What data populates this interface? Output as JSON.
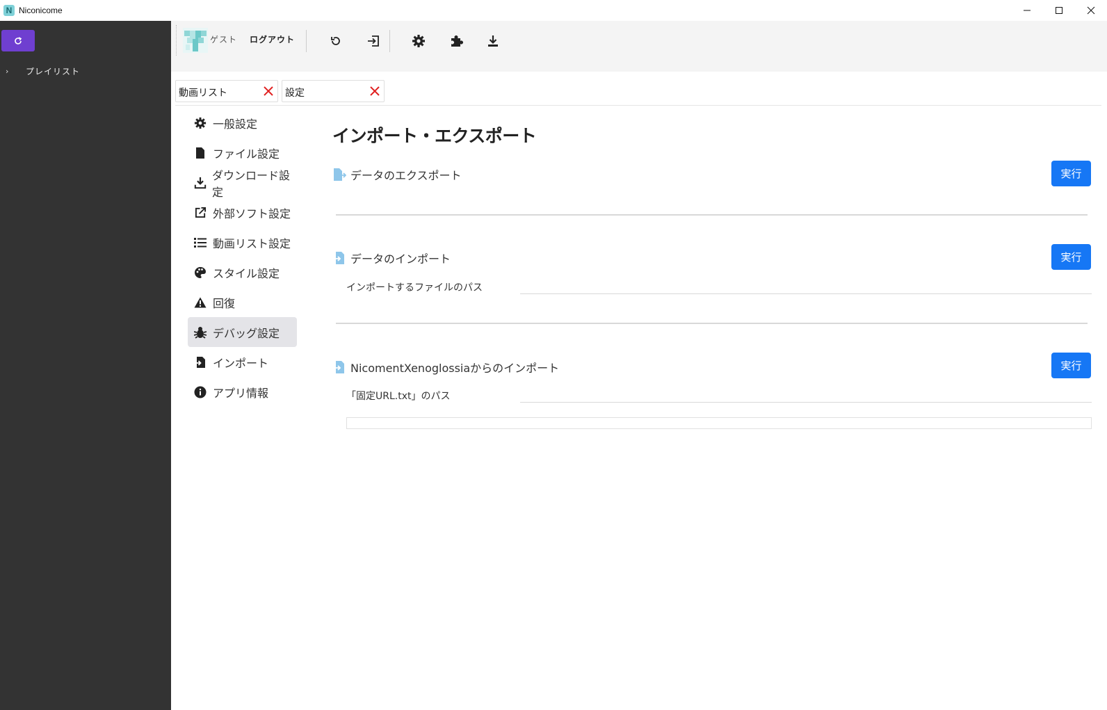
{
  "window": {
    "title": "Niconicome",
    "logo_letter": "N"
  },
  "sidebar": {
    "tree": [
      {
        "label": "プレイリスト"
      }
    ]
  },
  "toolbar": {
    "user": "ゲスト",
    "logout": "ログアウト",
    "icons": [
      "refresh-icon",
      "login-icon",
      "gear-icon",
      "puzzle-icon",
      "download-icon"
    ]
  },
  "tabs": [
    {
      "label": "動画リスト"
    },
    {
      "label": "設定"
    }
  ],
  "settings_nav": [
    {
      "label": "一般設定",
      "icon": "gear-icon"
    },
    {
      "label": "ファイル設定",
      "icon": "file-icon"
    },
    {
      "label": "ダウンロード設定",
      "icon": "download-icon"
    },
    {
      "label": "外部ソフト設定",
      "icon": "external-link-icon"
    },
    {
      "label": "動画リスト設定",
      "icon": "list-icon"
    },
    {
      "label": "スタイル設定",
      "icon": "palette-icon"
    },
    {
      "label": "回復",
      "icon": "warning-icon"
    },
    {
      "label": "デバッグ設定",
      "icon": "bug-icon",
      "active": true
    },
    {
      "label": "インポート",
      "icon": "file-import-icon"
    },
    {
      "label": "アプリ情報",
      "icon": "info-icon"
    }
  ],
  "main": {
    "title": "インポート・エクスポート",
    "export": {
      "label": "データのエクスポート",
      "button": "実行"
    },
    "import": {
      "label": "データのインポート",
      "button": "実行",
      "path_label": "インポートするファイルのパス",
      "path_value": ""
    },
    "xeno": {
      "label": "NicomentXenoglossiaからのインポート",
      "button": "実行",
      "path_label": "「固定URL.txt」のパス",
      "path_value": ""
    }
  },
  "colors": {
    "sidebar": "#333333",
    "accent_purple": "#6f3fd0",
    "primary_button": "#1677f5",
    "close_red": "#e02020"
  }
}
